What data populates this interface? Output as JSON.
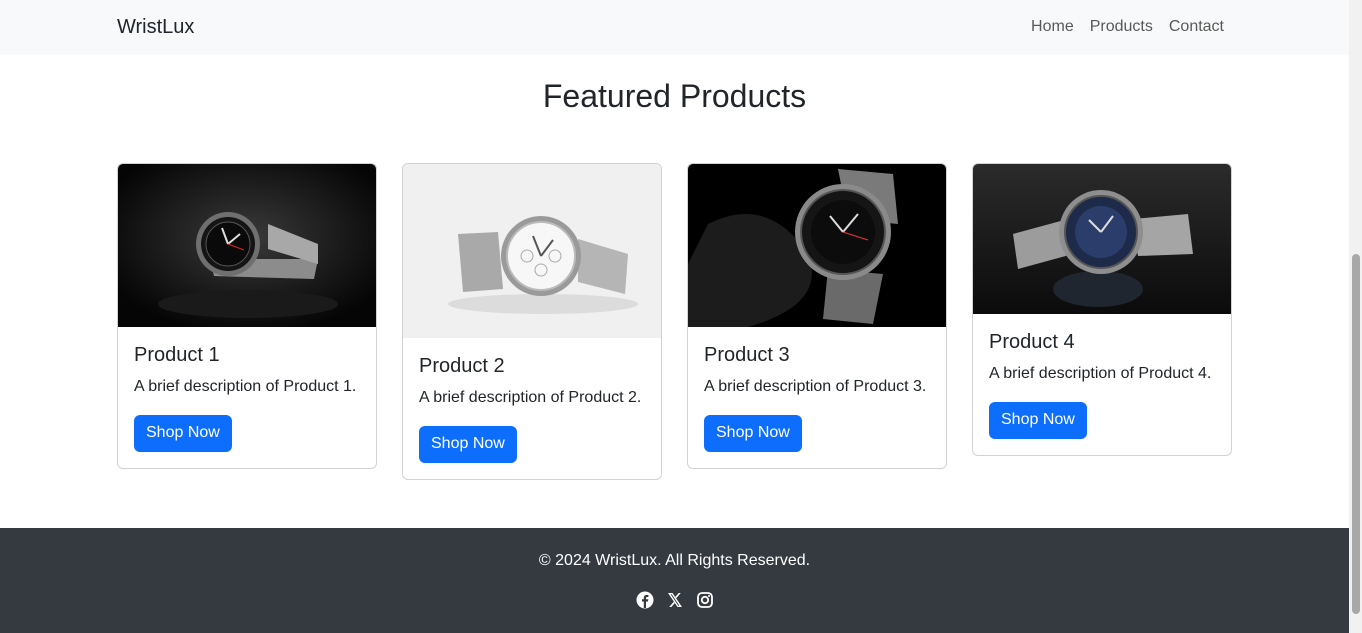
{
  "nav": {
    "brand": "WristLux",
    "links": [
      "Home",
      "Products",
      "Contact"
    ]
  },
  "main": {
    "title": "Featured Products",
    "products": [
      {
        "name": "Product 1",
        "description": "A brief description of Product 1.",
        "button": "Shop Now"
      },
      {
        "name": "Product 2",
        "description": "A brief description of Product 2.",
        "button": "Shop Now"
      },
      {
        "name": "Product 3",
        "description": "A brief description of Product 3.",
        "button": "Shop Now"
      },
      {
        "name": "Product 4",
        "description": "A brief description of Product 4.",
        "button": "Shop Now"
      }
    ]
  },
  "footer": {
    "copyright": "© 2024 WristLux. All Rights Reserved.",
    "social_icons": [
      "facebook-icon",
      "x-icon",
      "instagram-icon"
    ]
  },
  "colors": {
    "primary": "#0d6efd",
    "navbar_bg": "#f8f9fa",
    "footer_bg": "#343a40"
  }
}
